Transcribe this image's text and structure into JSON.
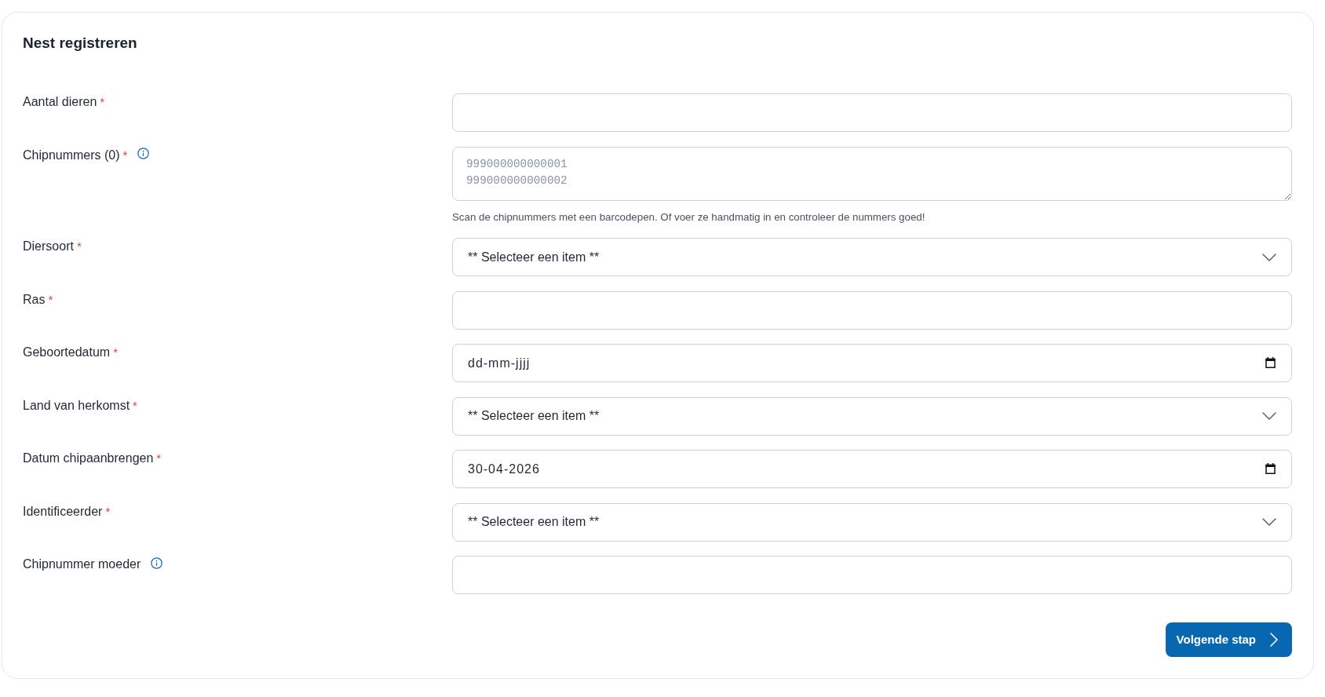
{
  "form": {
    "title": "Nest registreren",
    "fields": [
      {
        "kind": "text",
        "label": "Aantal dieren",
        "required_mark": "*",
        "info": false
      },
      {
        "kind": "textarea",
        "label": "Chipnummers (0)",
        "required_mark": "*",
        "info": true,
        "placeholder": "999000000000001\n999000000000002",
        "help": "Scan de chipnummers met een barcodepen. Of voer ze handmatig in en controleer de nummers goed!"
      },
      {
        "kind": "select",
        "label": "Diersoort",
        "required_mark": "*",
        "info": false,
        "value": "** Selecteer een item **"
      },
      {
        "kind": "text",
        "label": "Ras",
        "required_mark": "*",
        "info": false
      },
      {
        "kind": "date",
        "label": "Geboortedatum",
        "required_mark": "*",
        "info": false,
        "placeholder": "dd-mm-jjjj"
      },
      {
        "kind": "select",
        "label": "Land van herkomst",
        "required_mark": "*",
        "info": false,
        "value": "** Selecteer een item **"
      },
      {
        "kind": "date",
        "label": "Datum chipaanbrengen",
        "required_mark": "*",
        "info": false,
        "value": "30-04-2026"
      },
      {
        "kind": "select",
        "label": "Identificeerder",
        "required_mark": "*",
        "info": false,
        "value": "** Selecteer een item **"
      },
      {
        "kind": "text",
        "label": "Chipnummer moeder",
        "info": true
      }
    ],
    "next_button": {
      "label": "Volgende stap"
    }
  }
}
